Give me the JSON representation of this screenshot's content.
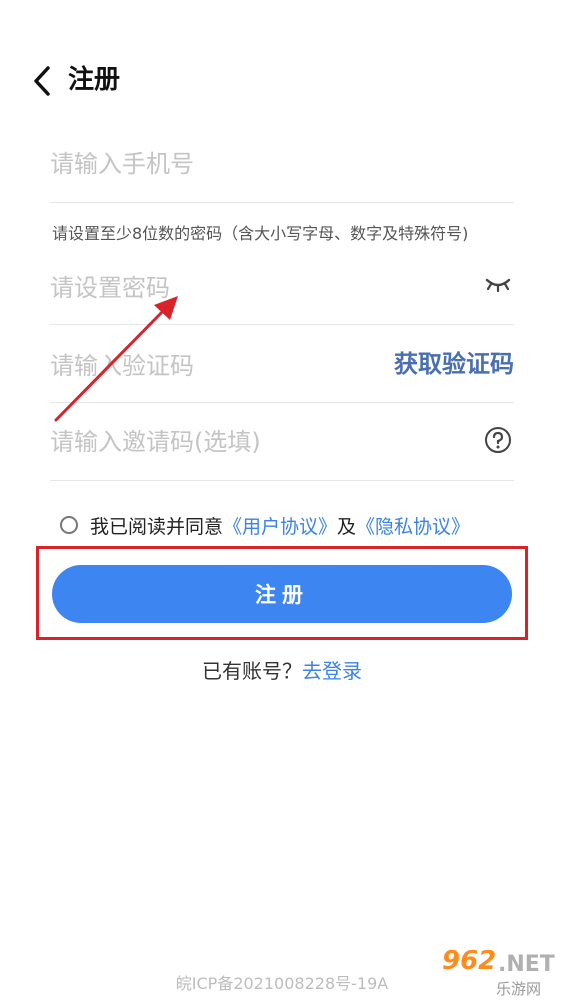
{
  "header": {
    "title": "注册"
  },
  "form": {
    "phone_placeholder": "请输入手机号",
    "password_hint": "请设置至少8位数的密码（含大小写字母、数字及特殊符号)",
    "password_placeholder": "请设置密码",
    "code_placeholder": "请输入验证码",
    "get_code_label": "获取验证码",
    "invite_placeholder": "请输入邀请码(选填)"
  },
  "agreement": {
    "prefix": "我已阅读并同意",
    "user_agreement": "《用户协议》",
    "conjunction": "及",
    "privacy_policy": "《隐私协议》",
    "checked": false
  },
  "register_button": {
    "label": "注册"
  },
  "login_prompt": {
    "question": "已有账号？",
    "link": "去登录"
  },
  "footer": {
    "icp": "皖ICP备2021008228号-19A"
  },
  "watermark": {
    "number": "962",
    "domain": ".NET",
    "site": "乐游网"
  },
  "colors": {
    "primary": "#3d85f0",
    "link": "#3b82e6",
    "highlight_box": "#d9232a",
    "annotation_arrow": "#d9232a"
  }
}
